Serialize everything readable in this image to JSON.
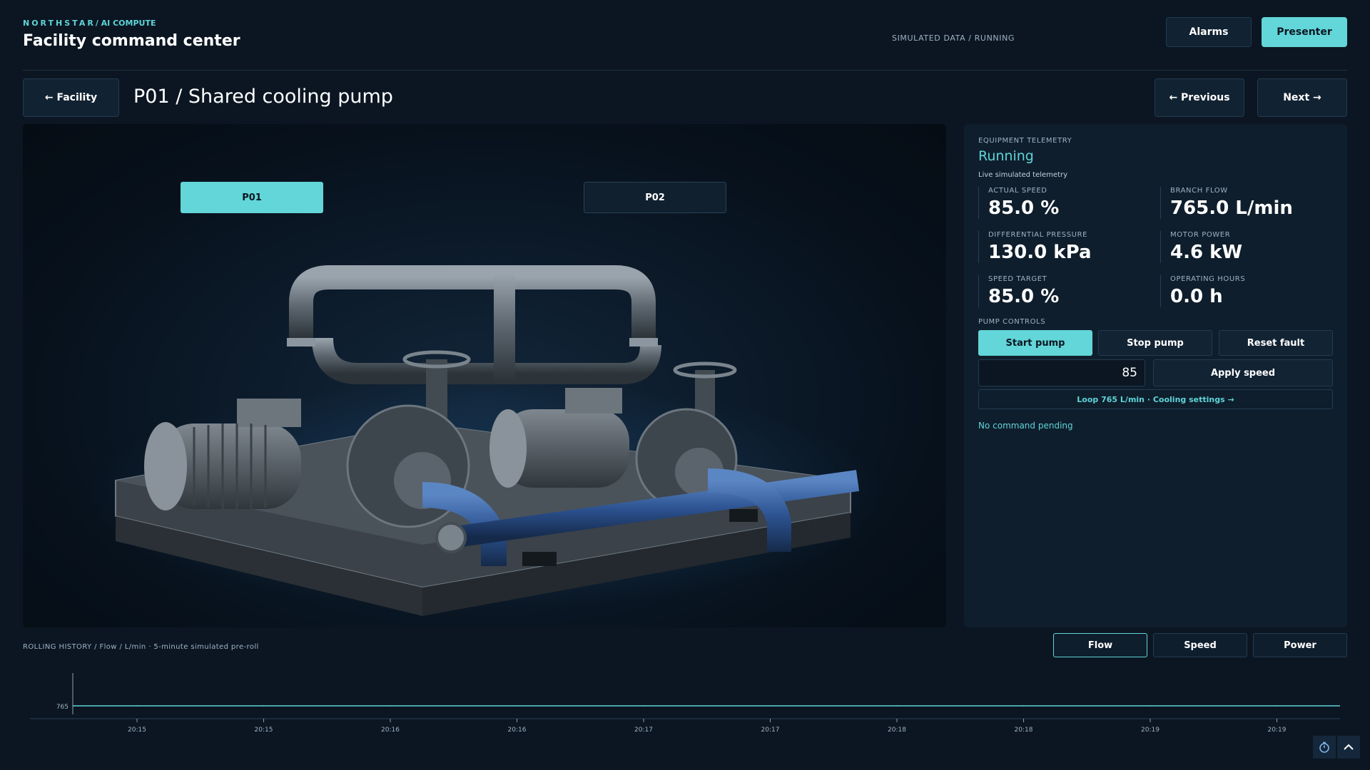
{
  "header": {
    "kicker": "NORTHSTAR",
    "kicker_tail": "/ AI COMPUTE",
    "title": "Facility command center",
    "status": "SIMULATED DATA / RUNNING",
    "alarms_label": "Alarms",
    "presenter_label": "Presenter"
  },
  "nav": {
    "back_label": "← Facility",
    "page_title": "P01 / Shared cooling pump",
    "prev_label": "← Previous",
    "next_label": "Next →"
  },
  "viewer": {
    "pumps": [
      {
        "label": "P01",
        "active": true
      },
      {
        "label": "P02",
        "active": false
      }
    ]
  },
  "telemetry": {
    "section": "EQUIPMENT TELEMETRY",
    "state": "Running",
    "subtitle": "Live simulated telemetry",
    "metrics": [
      {
        "label": "ACTUAL SPEED",
        "value": "85.0 %"
      },
      {
        "label": "BRANCH FLOW",
        "value": "765.0 L/min"
      },
      {
        "label": "DIFFERENTIAL PRESSURE",
        "value": "130.0 kPa"
      },
      {
        "label": "MOTOR POWER",
        "value": "4.6 kW"
      },
      {
        "label": "SPEED TARGET",
        "value": "85.0 %"
      },
      {
        "label": "OPERATING HOURS",
        "value": "0.0 h"
      }
    ]
  },
  "controls": {
    "section": "PUMP CONTROLS",
    "start_label": "Start pump",
    "stop_label": "Stop pump",
    "reset_label": "Reset fault",
    "speed_value": "85",
    "apply_label": "Apply speed",
    "loop_link": "Loop 765 L/min · Cooling settings →",
    "command_status": "No command pending"
  },
  "history": {
    "label": "ROLLING HISTORY / Flow / L/min · 5-minute simulated pre-roll",
    "tabs": [
      {
        "label": "Flow",
        "active": true
      },
      {
        "label": "Speed",
        "active": false
      },
      {
        "label": "Power",
        "active": false
      }
    ]
  },
  "colors": {
    "accent": "#62d6d8",
    "background": "#0b1622",
    "panel": "#0f1e2c"
  },
  "icons": {
    "timer": "stopwatch-icon",
    "collapse": "chevron-up-icon"
  },
  "chart_data": {
    "type": "line",
    "title": "",
    "xlabel": "",
    "ylabel": "",
    "x": [
      "20:15",
      "20:15",
      "20:16",
      "20:16",
      "20:17",
      "20:17",
      "20:18",
      "20:18",
      "20:19",
      "20:19"
    ],
    "series": [
      {
        "values": [
          765,
          765,
          765,
          765,
          765,
          765,
          765,
          765,
          765,
          765
        ]
      }
    ],
    "y_ticks": [
      "765"
    ],
    "grid": false
  }
}
